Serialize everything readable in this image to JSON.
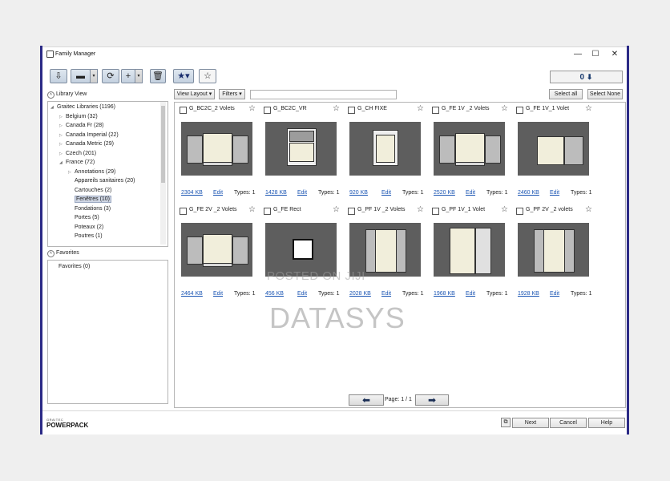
{
  "window": {
    "title": "Family Manager"
  },
  "titlebar": {
    "minimize": "—",
    "maximize": "☐",
    "close": "✕"
  },
  "toolbar": {
    "counter_value": "0"
  },
  "library_view": {
    "label": "Library View",
    "items": [
      {
        "label": "Graitec Libraries (1196)",
        "level": 0,
        "expand": "open"
      },
      {
        "label": "Belgium (32)",
        "level": 1,
        "expand": "closed"
      },
      {
        "label": "Canada Fr (28)",
        "level": 1,
        "expand": "closed"
      },
      {
        "label": "Canada Imperial (22)",
        "level": 1,
        "expand": "closed"
      },
      {
        "label": "Canada Metric (29)",
        "level": 1,
        "expand": "closed"
      },
      {
        "label": "Czech (201)",
        "level": 1,
        "expand": "closed"
      },
      {
        "label": "France (72)",
        "level": 1,
        "expand": "open"
      },
      {
        "label": "Annotations (29)",
        "level": 2,
        "expand": "closed"
      },
      {
        "label": "Appareils sanitaires (20)",
        "level": 2,
        "expand": "none"
      },
      {
        "label": "Cartouches (2)",
        "level": 2,
        "expand": "none"
      },
      {
        "label": "Fenêtres (10)",
        "level": 2,
        "expand": "none",
        "selected": true
      },
      {
        "label": "Fondations (3)",
        "level": 2,
        "expand": "none"
      },
      {
        "label": "Portes (5)",
        "level": 2,
        "expand": "none"
      },
      {
        "label": "Poteaux (2)",
        "level": 2,
        "expand": "none"
      },
      {
        "label": "Poutres (1)",
        "level": 2,
        "expand": "none"
      }
    ]
  },
  "favorites": {
    "label": "Favorites",
    "item": "Favorites (0)"
  },
  "controls": {
    "view_layout": "View Layout",
    "filters": "Filters",
    "select_all": "Select all",
    "select_none": "Select None"
  },
  "cards": [
    {
      "name": "G_BC2C_2 Volets",
      "size": "2304 KB",
      "edit": "Edit",
      "types": "Types: 1",
      "kind": "shutters"
    },
    {
      "name": "G_BC2C_VR",
      "size": "1428 KB",
      "edit": "Edit",
      "types": "Types: 1",
      "kind": "roller"
    },
    {
      "name": "G_CH FIXE",
      "size": "920 KB",
      "edit": "Edit",
      "types": "Types: 1",
      "kind": "fixed"
    },
    {
      "name": "G_FE 1V _2 Volets",
      "size": "2520 KB",
      "edit": "Edit",
      "types": "Types: 1",
      "kind": "shutters"
    },
    {
      "name": "G_FE 1V_1 Volet",
      "size": "2460 KB",
      "edit": "Edit",
      "types": "Types: 1",
      "kind": "one-shutter"
    },
    {
      "name": "G_FE 2V _2 Volets",
      "size": "2464 KB",
      "edit": "Edit",
      "types": "Types: 1",
      "kind": "shutters"
    },
    {
      "name": "G_FE Rect",
      "size": "456 KB",
      "edit": "Edit",
      "types": "Types: 1",
      "kind": "rect"
    },
    {
      "name": "G_PF 1V _2 Volets",
      "size": "2028 KB",
      "edit": "Edit",
      "types": "Types: 1",
      "kind": "door-shutters"
    },
    {
      "name": "G_PF 1V_1 Volet",
      "size": "1968 KB",
      "edit": "Edit",
      "types": "Types: 1",
      "kind": "door-one"
    },
    {
      "name": "G_PF 2V _2 volets",
      "size": "1928 KB",
      "edit": "Edit",
      "types": "Types: 1",
      "kind": "door-shutters"
    }
  ],
  "pagination": {
    "label": "Page: 1 / 1"
  },
  "footer": {
    "brand_small": "GRAITEC",
    "brand_big": "POWERPACK",
    "next": "Next",
    "cancel": "Cancel",
    "help": "Help"
  },
  "watermark": {
    "line1": "POSTED ON JIJI",
    "line2": "DATASYS"
  },
  "colors": {
    "accent_stripe": "#2b2a86",
    "link": "#1b55b3",
    "thumb_bg": "#5e5e5e"
  }
}
